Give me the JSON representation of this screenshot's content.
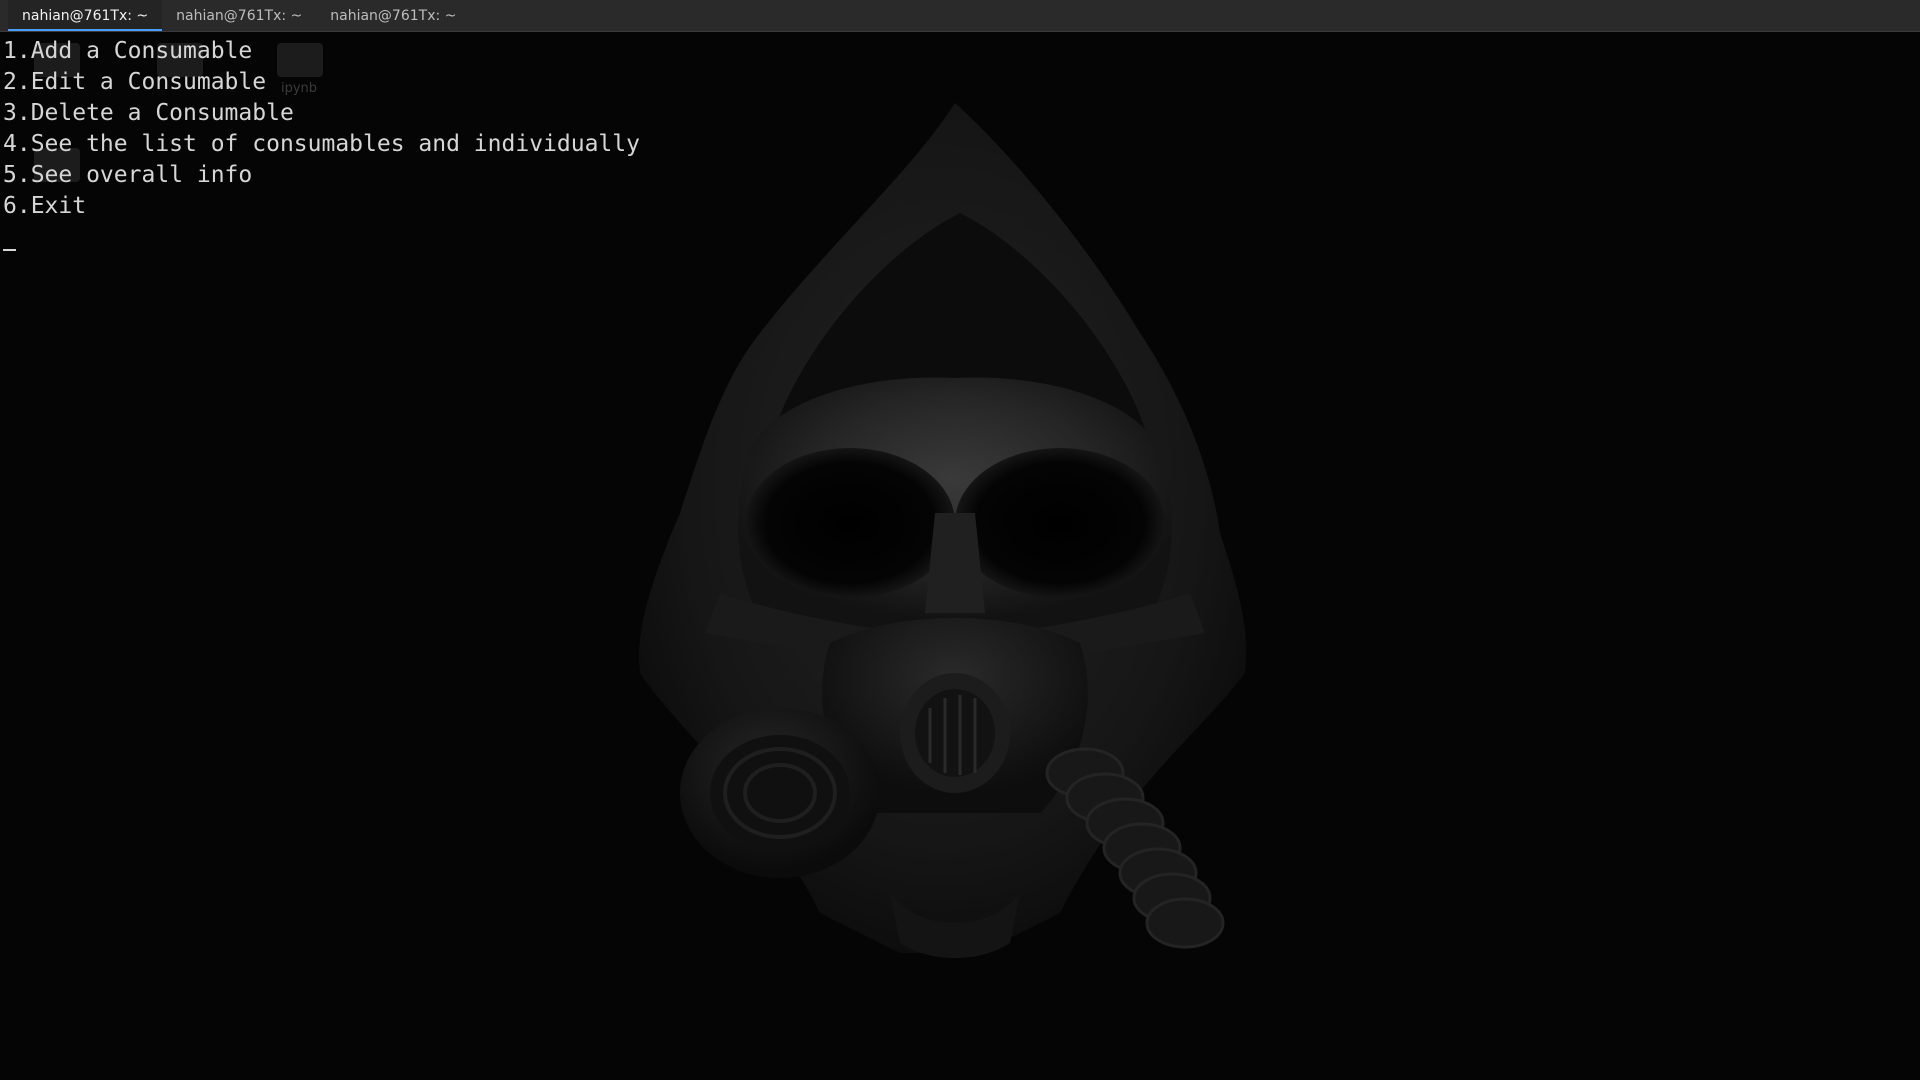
{
  "tabs": [
    {
      "label": "nahian@761Tx: ~",
      "active": true
    },
    {
      "label": "nahian@761Tx: ~",
      "active": false
    },
    {
      "label": "nahian@761Tx: ~",
      "active": false
    }
  ],
  "terminal": {
    "menu_lines": [
      "1.Add a Consumable",
      "2.Edit a Consumable",
      "3.Delete a Consumable",
      "4.See the list of consumables and individually",
      "5.See overall info",
      "6.Exit"
    ],
    "background": "#050505",
    "foreground": "#d6d6d6"
  },
  "desktop_ghost": {
    "icon_label": "ipynb"
  },
  "wallpaper": {
    "subject": "hooded-gas-mask-figure"
  },
  "colors": {
    "tabbar": "#2a2a2a",
    "tab_active_underline": "#4a9eff"
  }
}
